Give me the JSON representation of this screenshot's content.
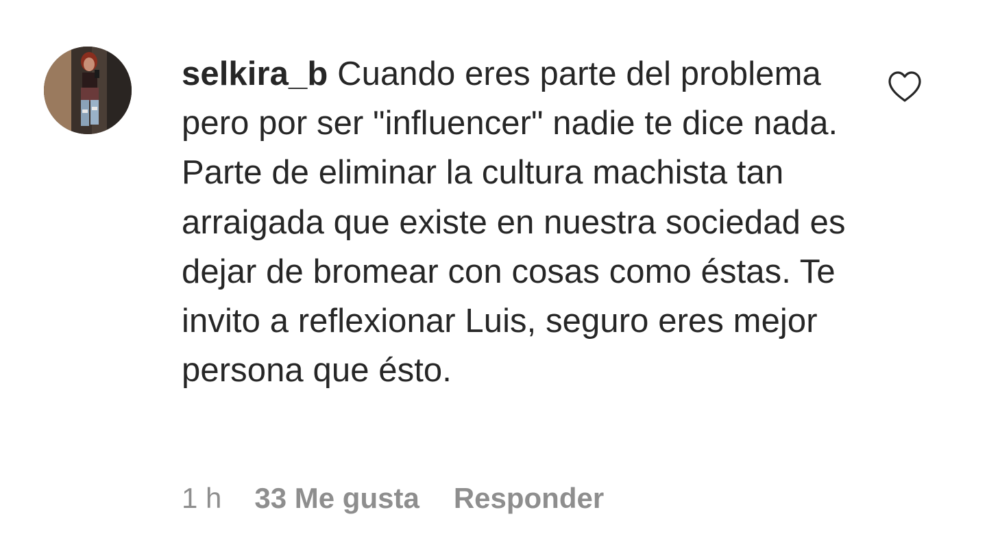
{
  "comment": {
    "username": "selkira_b",
    "text": "Cuando eres parte del problema pero por ser \"influencer\" nadie te dice nada. Parte de eliminar la cultura machista tan arraigada que existe en nuestra sociedad es dejar de bromear con cosas como éstas. Te invito a reflexionar Luis, seguro eres mejor persona que ésto.",
    "avatar_icon": "profile-photo",
    "like_icon": "heart-outline-icon"
  },
  "meta": {
    "time": "1 h",
    "likes": "33 Me gusta",
    "reply": "Responder"
  },
  "colors": {
    "text": "#262626",
    "secondary": "#8e8e8e",
    "background": "#ffffff"
  }
}
